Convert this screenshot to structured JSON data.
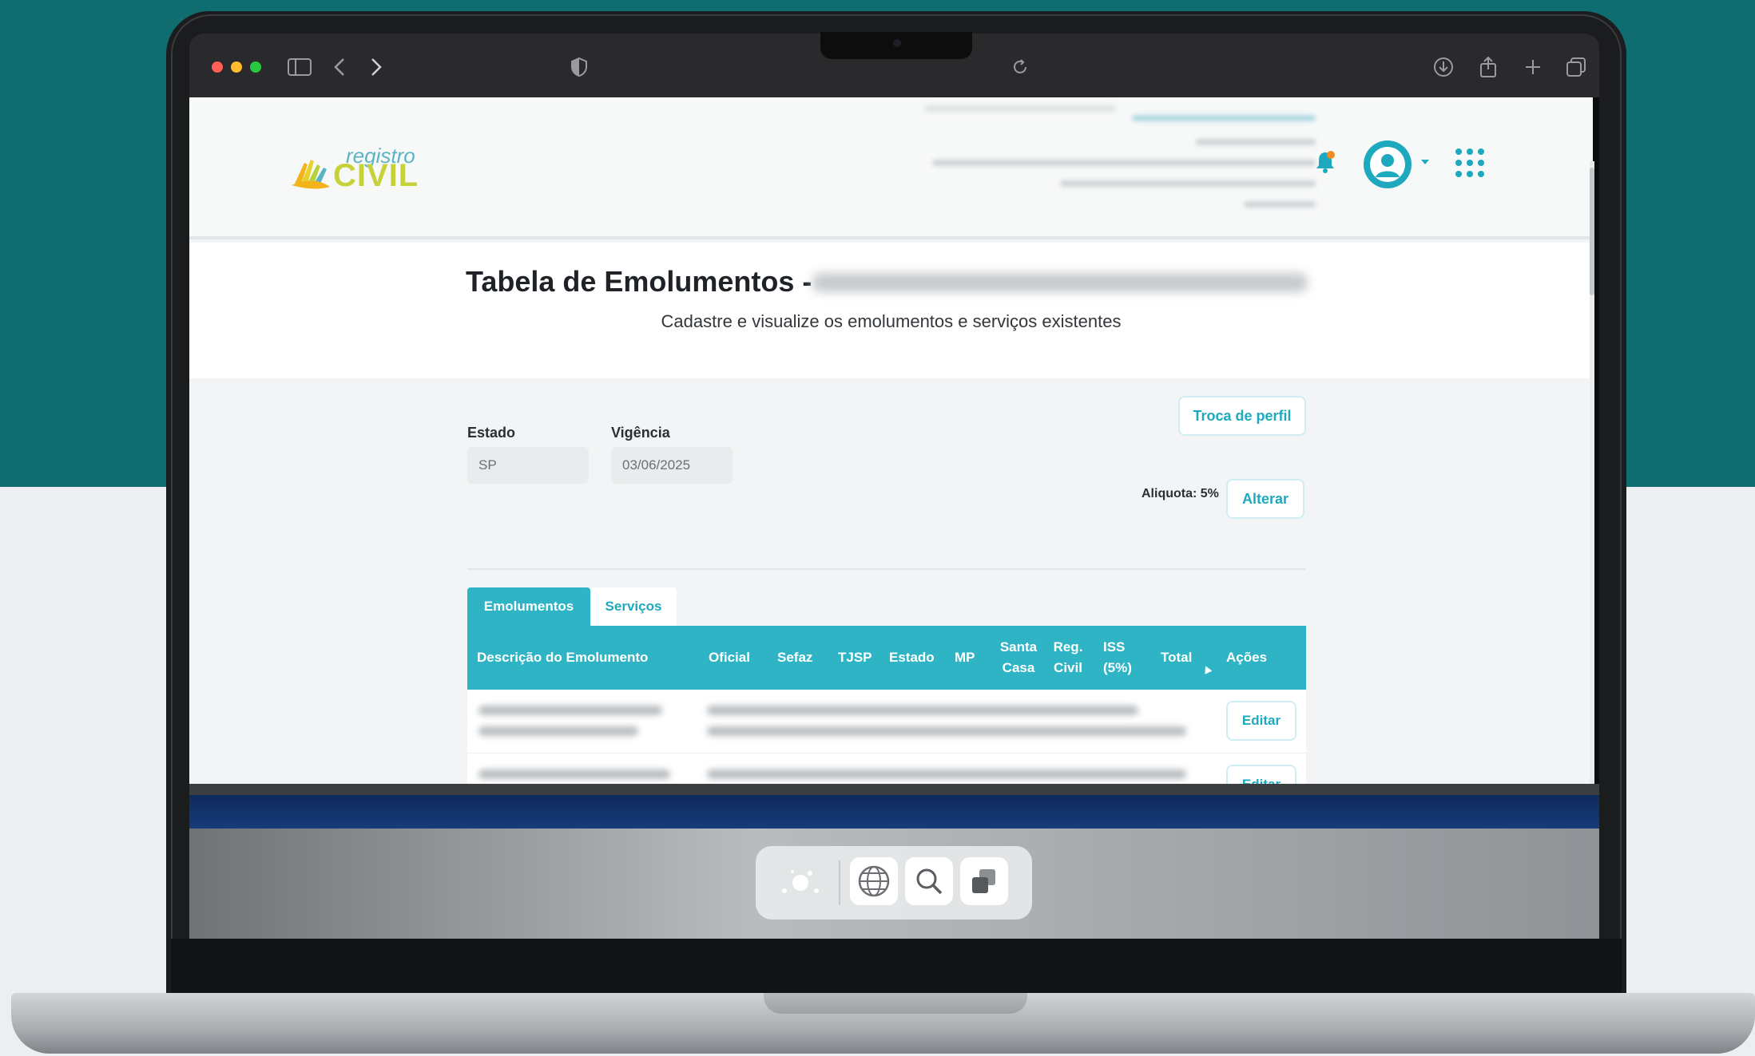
{
  "browser": {
    "toolbar_icons": [
      "sidebar-icon",
      "back-icon",
      "forward-icon",
      "privacy-shield-icon",
      "reload-icon",
      "download-icon",
      "share-icon",
      "new-tab-icon",
      "tabs-overview-icon"
    ]
  },
  "header": {
    "logo": {
      "small": "registro",
      "big": "CIVIL"
    },
    "icons": [
      "bell-icon",
      "avatar-icon",
      "apps-grid-icon"
    ],
    "notification_color": "#f08a24"
  },
  "page": {
    "title": "Tabela de Emolumentos -",
    "subtitle": "Cadastre e visualize os emolumentos e serviços existentes"
  },
  "filters": {
    "estado_label": "Estado",
    "estado_value": "SP",
    "vigencia_label": "Vigência",
    "vigencia_value": "03/06/2025",
    "troca_perfil_button": "Troca de perfil",
    "aliquota_text": "Aliquota: 5%",
    "alterar_button": "Alterar"
  },
  "tabs": [
    {
      "label": "Emolumentos",
      "active": true
    },
    {
      "label": "Serviços",
      "active": false
    }
  ],
  "table": {
    "columns": [
      {
        "key": "descricao",
        "lines": [
          "Descrição do Emolumento"
        ]
      },
      {
        "key": "oficial",
        "lines": [
          "Oficial"
        ]
      },
      {
        "key": "sefaz",
        "lines": [
          "Sefaz"
        ]
      },
      {
        "key": "tjsp",
        "lines": [
          "TJSP"
        ]
      },
      {
        "key": "estado",
        "lines": [
          "Estado"
        ]
      },
      {
        "key": "mp",
        "lines": [
          "MP"
        ]
      },
      {
        "key": "santa_casa",
        "lines": [
          "Santa",
          "Casa"
        ]
      },
      {
        "key": "reg_civil",
        "lines": [
          "Reg.",
          "Civil"
        ]
      },
      {
        "key": "iss",
        "lines": [
          "ISS",
          "(5%)"
        ]
      },
      {
        "key": "total",
        "lines": [
          "Total"
        ]
      },
      {
        "key": "acoes",
        "lines": [
          "Ações"
        ]
      }
    ],
    "rows": [
      {
        "action_label": "Editar"
      },
      {
        "action_label": "Editar"
      }
    ]
  },
  "colors": {
    "accent": "#2fb4c6",
    "teal_background": "#0f6d70",
    "logo_yellow": "#c7d23a"
  },
  "dock": {
    "items": [
      "genmoji-icon",
      "globe-icon",
      "search-icon",
      "window-switcher-icon"
    ]
  }
}
